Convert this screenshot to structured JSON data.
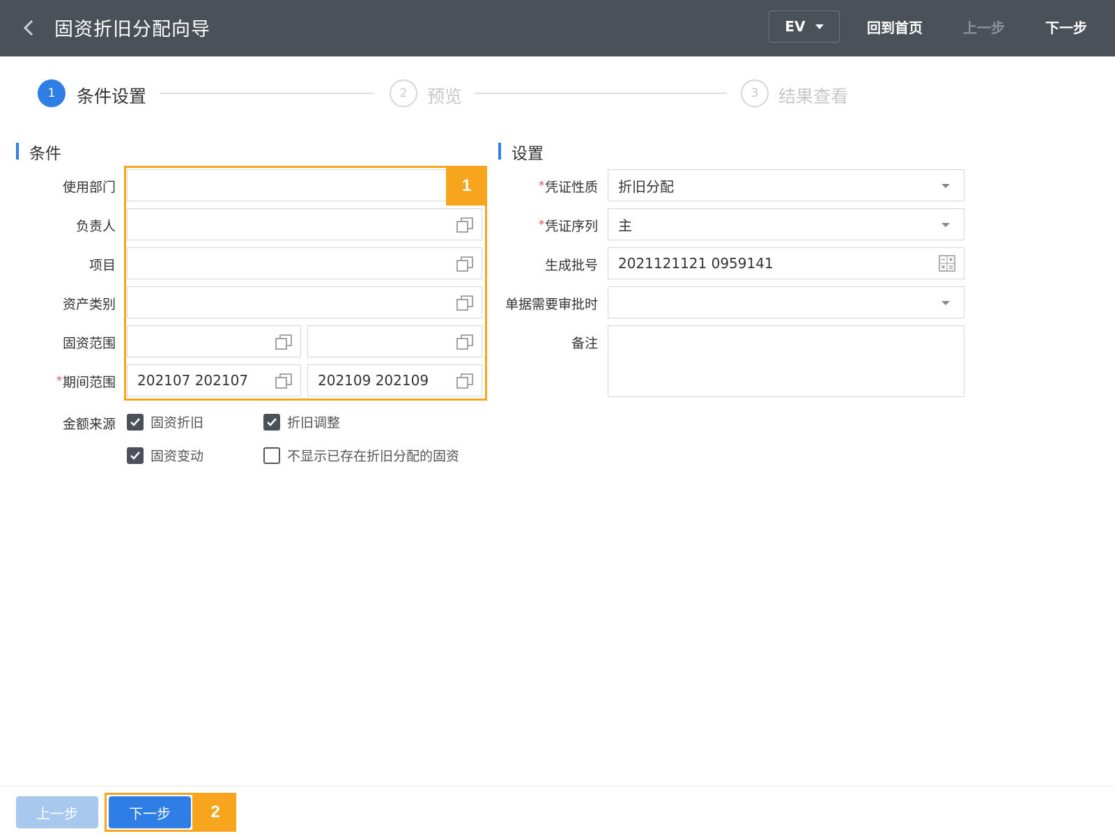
{
  "header": {
    "title": "固资折旧分配向导",
    "ev_value": "EV",
    "home_label": "回到首页",
    "prev_label": "上一步",
    "next_label": "下一步"
  },
  "steps": [
    {
      "num": "1",
      "label": "条件设置",
      "active": true
    },
    {
      "num": "2",
      "label": "预览",
      "active": false
    },
    {
      "num": "3",
      "label": "结果查看",
      "active": false
    }
  ],
  "conditions": {
    "title": "条件",
    "fields": {
      "dept": {
        "label": "使用部门",
        "value": ""
      },
      "owner": {
        "label": "负责人",
        "value": ""
      },
      "project": {
        "label": "项目",
        "value": ""
      },
      "asset_type": {
        "label": "资产类别",
        "value": ""
      },
      "asset_range": {
        "label": "固资范围",
        "from": "",
        "to": ""
      },
      "period_range": {
        "label": "期间范围",
        "from": "202107 202107",
        "to": "202109 202109"
      }
    },
    "amount_source": {
      "label": "金额来源",
      "options": [
        {
          "label": "固资折旧",
          "checked": true
        },
        {
          "label": "折旧调整",
          "checked": true
        },
        {
          "label": "固资变动",
          "checked": true
        },
        {
          "label": "不显示已存在折旧分配的固资",
          "checked": false
        }
      ]
    }
  },
  "settings": {
    "title": "设置",
    "fields": {
      "voucher_type": {
        "label": "凭证性质",
        "value": "折旧分配"
      },
      "voucher_seq": {
        "label": "凭证序列",
        "value": "主"
      },
      "batch_no": {
        "label": "生成批号",
        "value": "2021121121 0959141"
      },
      "approval": {
        "label": "单据需要审批时",
        "value": ""
      },
      "remark": {
        "label": "备注",
        "value": ""
      }
    }
  },
  "annotations": [
    "1",
    "2"
  ],
  "footer": {
    "prev_label": "上一步",
    "next_label": "下一步"
  },
  "colors": {
    "header_bg": "#4a5159",
    "primary": "#2e7ee6",
    "annotation": "#f7a51c",
    "disabled_btn": "#a9c8ee"
  },
  "icons": {
    "back": "chevron-left-icon",
    "reference": "reference-copy-icon",
    "calculator": "calculator-icon"
  }
}
